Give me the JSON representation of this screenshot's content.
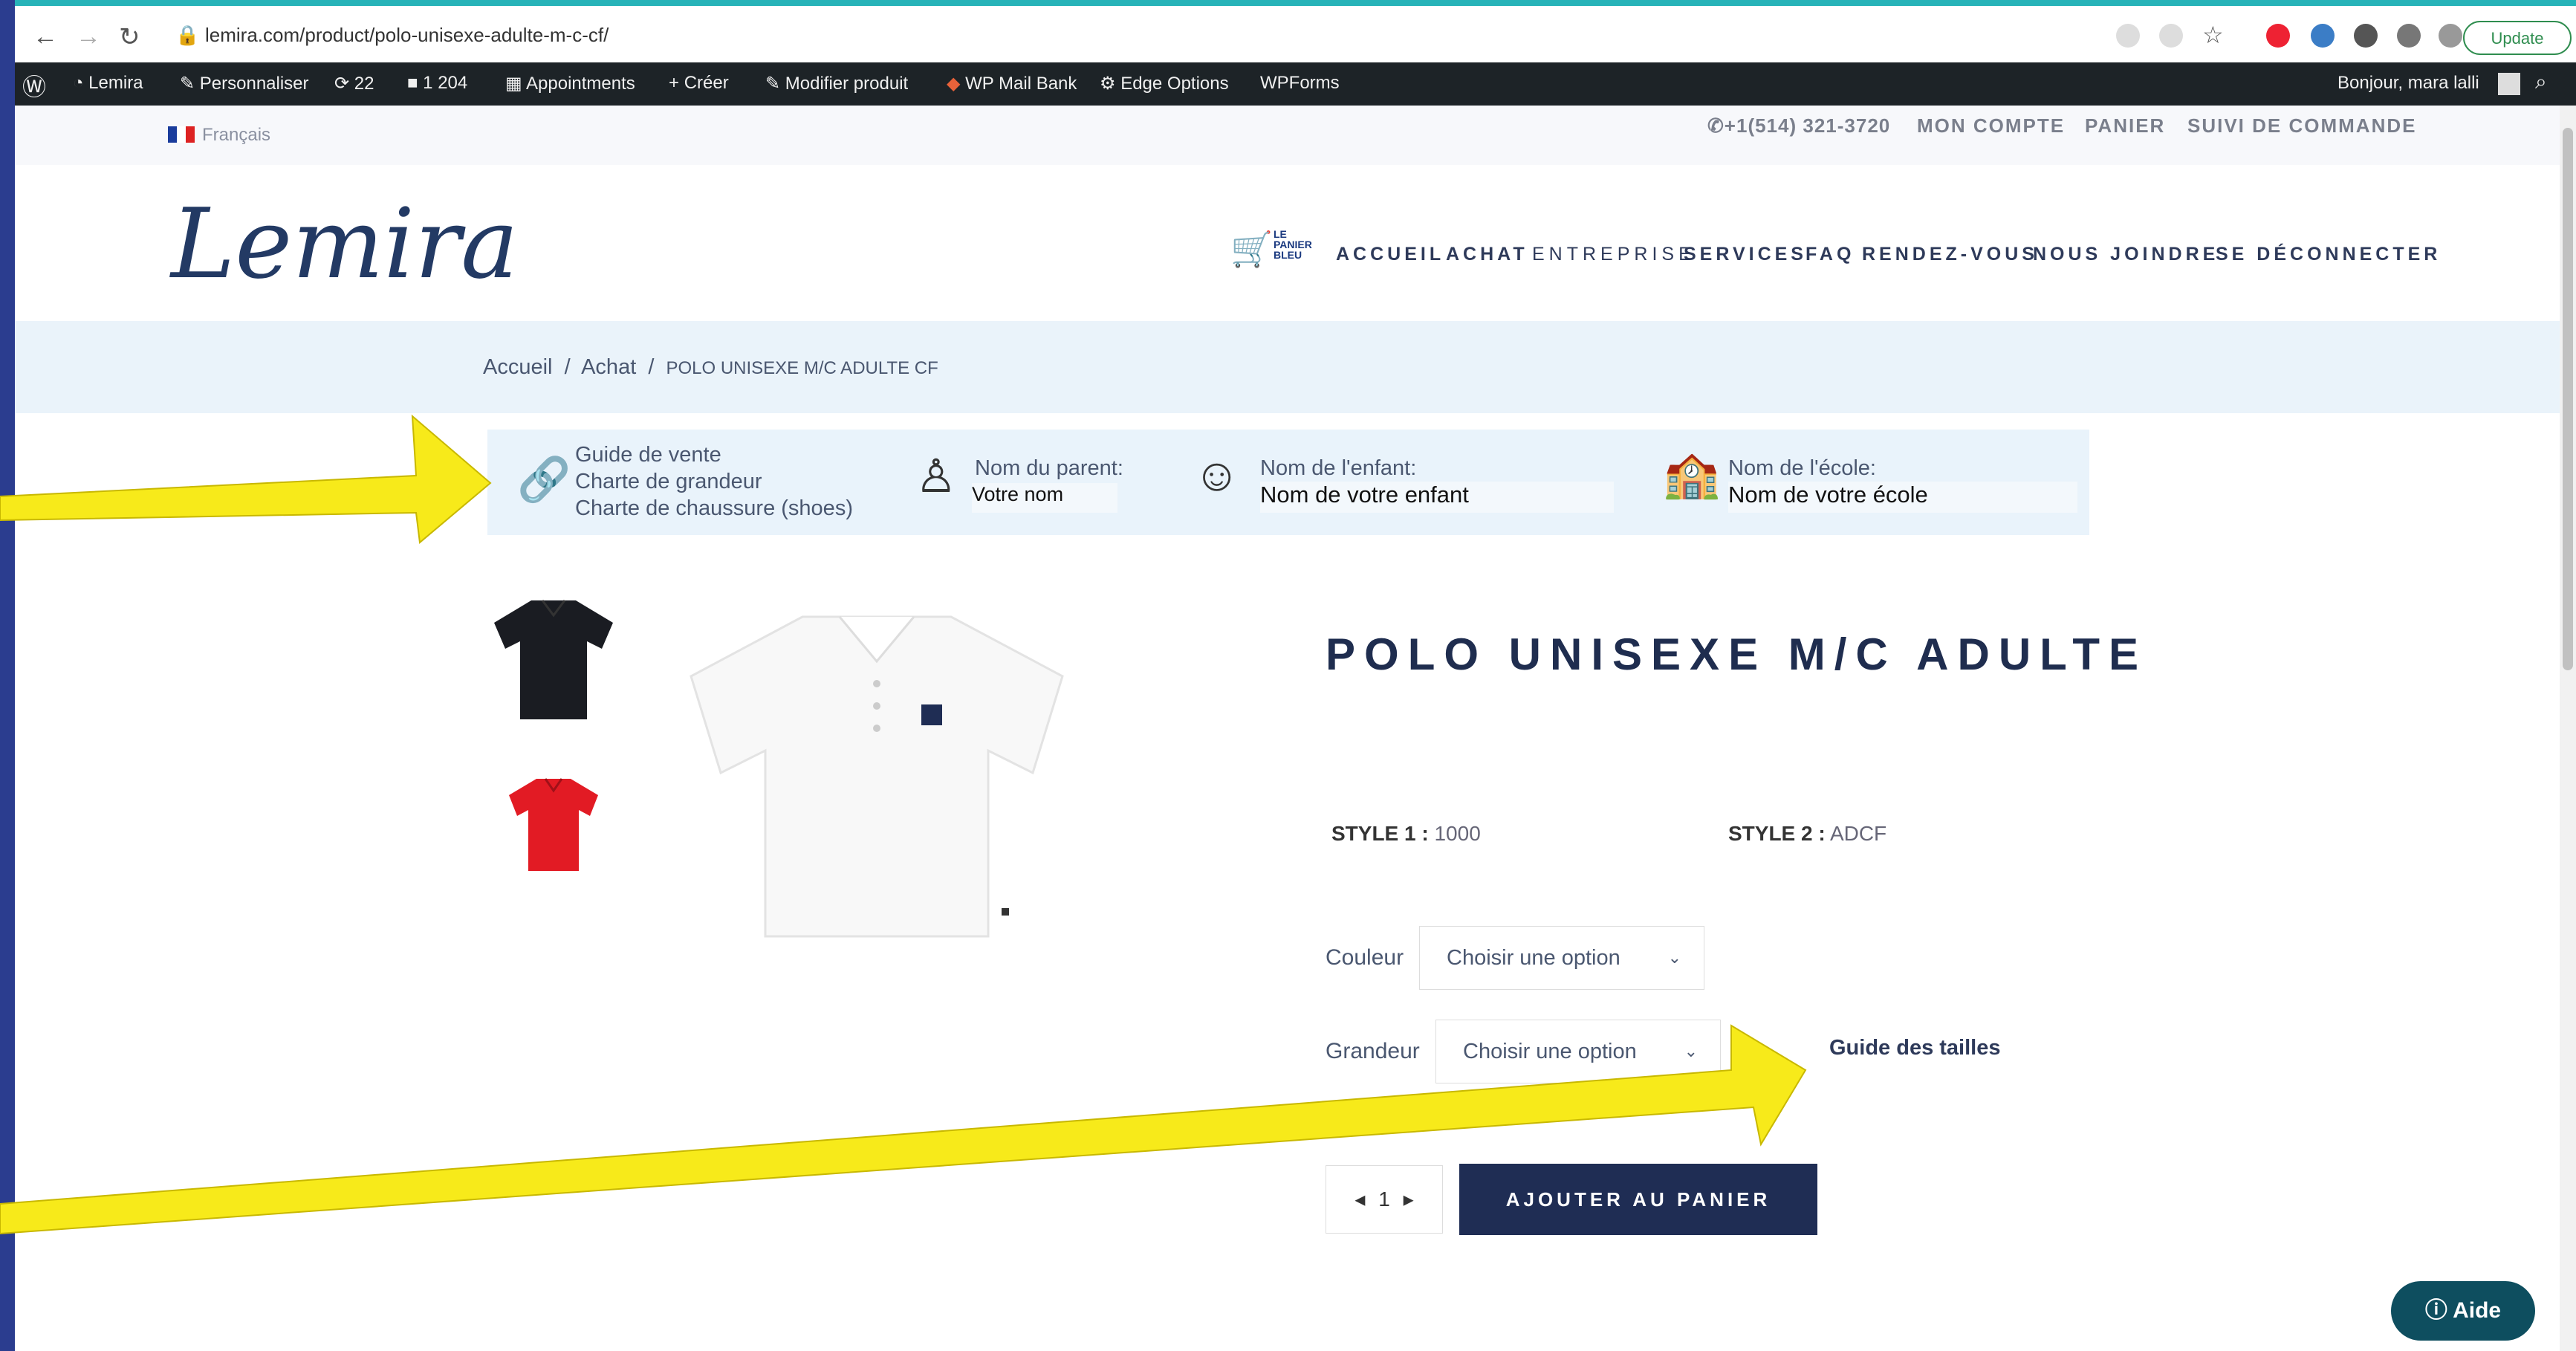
{
  "browser": {
    "url": "lemira.com/product/polo-unisexe-adulte-m-c-cf/",
    "update_label": "Update"
  },
  "adminbar": {
    "site": "Lemira",
    "customize": "Personnaliser",
    "updates_count": "22",
    "comments_count": "1 204",
    "appointments": "Appointments",
    "create": "Créer",
    "edit_product": "Modifier produit",
    "mail_bank": "WP Mail Bank",
    "edge_options": "Edge Options",
    "wpforms": "WPForms",
    "greeting": "Bonjour, mara lalli"
  },
  "topbar": {
    "language": "Français",
    "phone": "+1(514) 321-3720",
    "links": [
      "MON COMPTE",
      "PANIER",
      "SUIVI DE COMMANDE"
    ]
  },
  "header": {
    "logo": "Lemira",
    "cart_badge": [
      "LE",
      "PANIER",
      "BLEU"
    ],
    "nav": [
      "ACCUEIL",
      "ACHAT",
      "ENTREPRISE",
      "SERVICES",
      "FAQ",
      "RENDEZ-VOUS",
      "NOUS JOINDRE",
      "SE DÉCONNECTER"
    ]
  },
  "breadcrumb": {
    "items": [
      "Accueil",
      "/",
      "Achat",
      "/",
      "POLO UNISEXE M/C ADULTE CF"
    ]
  },
  "info": {
    "links": [
      "Guide de vente",
      "Charte de grandeur",
      "Charte de chaussure (shoes)"
    ],
    "parent_label": "Nom du parent:",
    "parent_value": "Votre nom",
    "child_label": "Nom de l'enfant:",
    "child_value": "Nom de votre enfant",
    "school_label": "Nom de l'école:",
    "school_value": "Nom de votre école"
  },
  "product": {
    "title": "POLO UNISEXE M/C ADULTE",
    "style1_label": "STYLE 1 :",
    "style1_value": "1000",
    "style2_label": "STYLE 2 :",
    "style2_value": "ADCF",
    "color_label": "Couleur",
    "color_placeholder": "Choisir une option",
    "size_label": "Grandeur",
    "size_placeholder": "Choisir une option",
    "size_guide": "Guide des tailles",
    "qty": "1",
    "add_to_cart": "AJOUTER AU PANIER"
  },
  "help": {
    "label": "Aide"
  },
  "colors": {
    "accent": "#1f2d54",
    "annotation": "#f7ea1a",
    "admin_bar": "#1d2327"
  }
}
